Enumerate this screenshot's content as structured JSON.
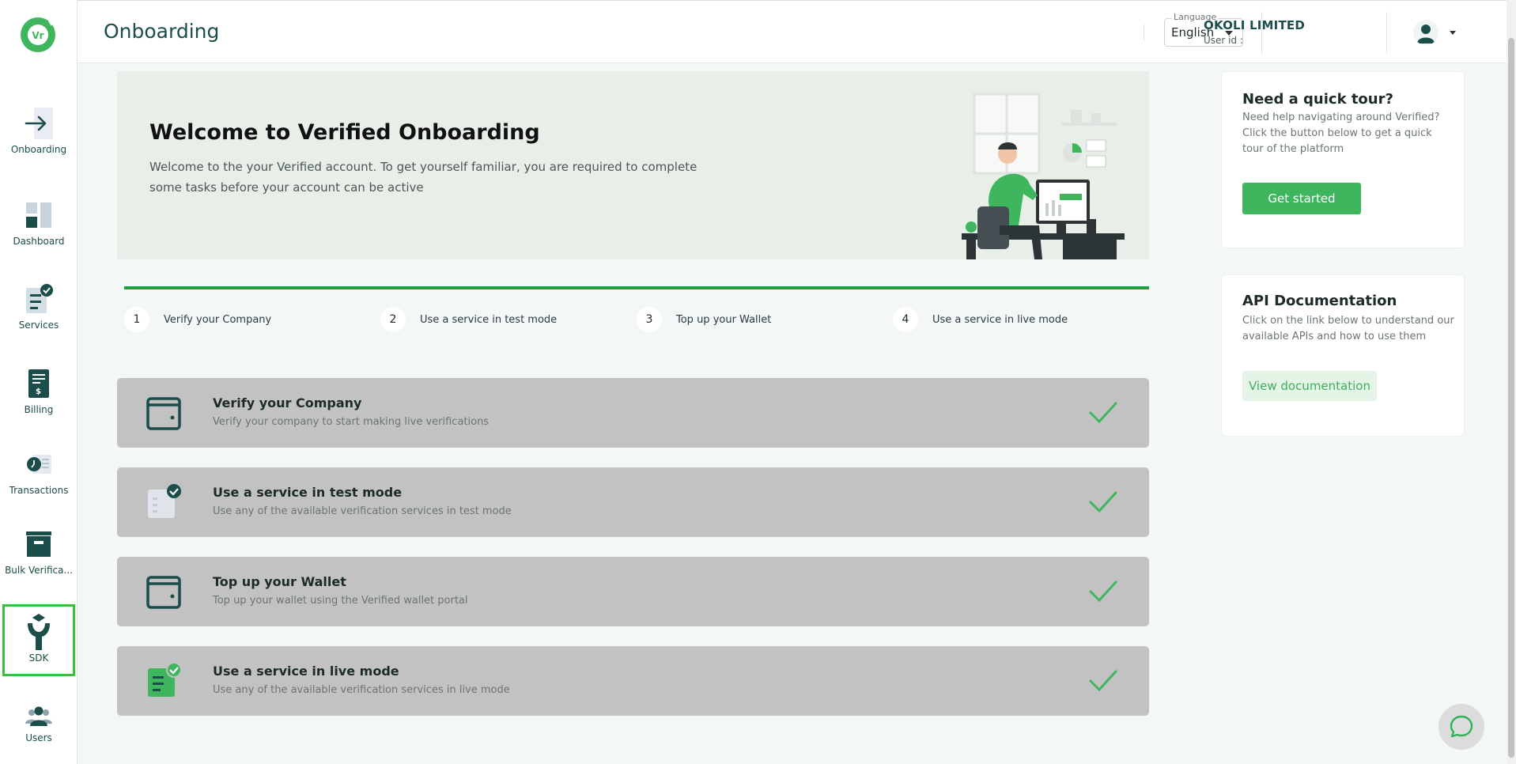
{
  "header": {
    "page_title": "Onboarding",
    "language_caption": "Language",
    "language_value": "English",
    "company_name": "OKOLI LIMITED",
    "user_id_label": "User id :"
  },
  "sidebar": {
    "logo_text": "Vr",
    "items": [
      {
        "label": "Onboarding",
        "icon": "arrow-right-icon"
      },
      {
        "label": "Dashboard",
        "icon": "dashboard-icon"
      },
      {
        "label": "Services",
        "icon": "services-icon"
      },
      {
        "label": "Billing",
        "icon": "billing-icon"
      },
      {
        "label": "Transactions",
        "icon": "transactions-icon"
      },
      {
        "label": "Bulk Verifica...",
        "icon": "bulk-verification-icon"
      },
      {
        "label": "SDK",
        "icon": "sdk-icon"
      },
      {
        "label": "Users",
        "icon": "users-icon"
      }
    ]
  },
  "banner": {
    "title": "Welcome to Verified Onboarding",
    "text": "Welcome to the your Verified account. To get yourself familiar, you are required to complete some tasks before your account can be active"
  },
  "steps": [
    {
      "num": "1",
      "label": "Verify your Company"
    },
    {
      "num": "2",
      "label": "Use a service in test mode"
    },
    {
      "num": "3",
      "label": "Top up your Wallet"
    },
    {
      "num": "4",
      "label": "Use a service in live mode"
    }
  ],
  "tasks": [
    {
      "title": "Verify your Company",
      "desc": "Verify your company to start making live verifications",
      "icon": "wallet-icon",
      "done": true
    },
    {
      "title": "Use a service in test mode",
      "desc": "Use any of the available verification services in test mode",
      "icon": "test-services-icon",
      "done": true
    },
    {
      "title": "Top up your Wallet",
      "desc": "Top up your wallet using the Verified wallet portal",
      "icon": "wallet-icon",
      "done": true
    },
    {
      "title": "Use a service in live mode",
      "desc": "Use any of the available verification services in live mode",
      "icon": "live-services-icon",
      "done": true
    }
  ],
  "tour_card": {
    "title": "Need a quick tour?",
    "text": "Need help navigating around Verified? Click the button below to get a quick tour of the platform",
    "button": "Get started"
  },
  "api_card": {
    "title": "API Documentation",
    "text": "Click on the link below to understand our available APIs and how to use them",
    "button": "View documentation"
  },
  "colors": {
    "brand_green": "#3fb65e",
    "dark_teal": "#1b4d4a",
    "progress": "#1f9d3a",
    "task_bg": "#c2c2c2",
    "selected_outline": "#35c13a"
  }
}
